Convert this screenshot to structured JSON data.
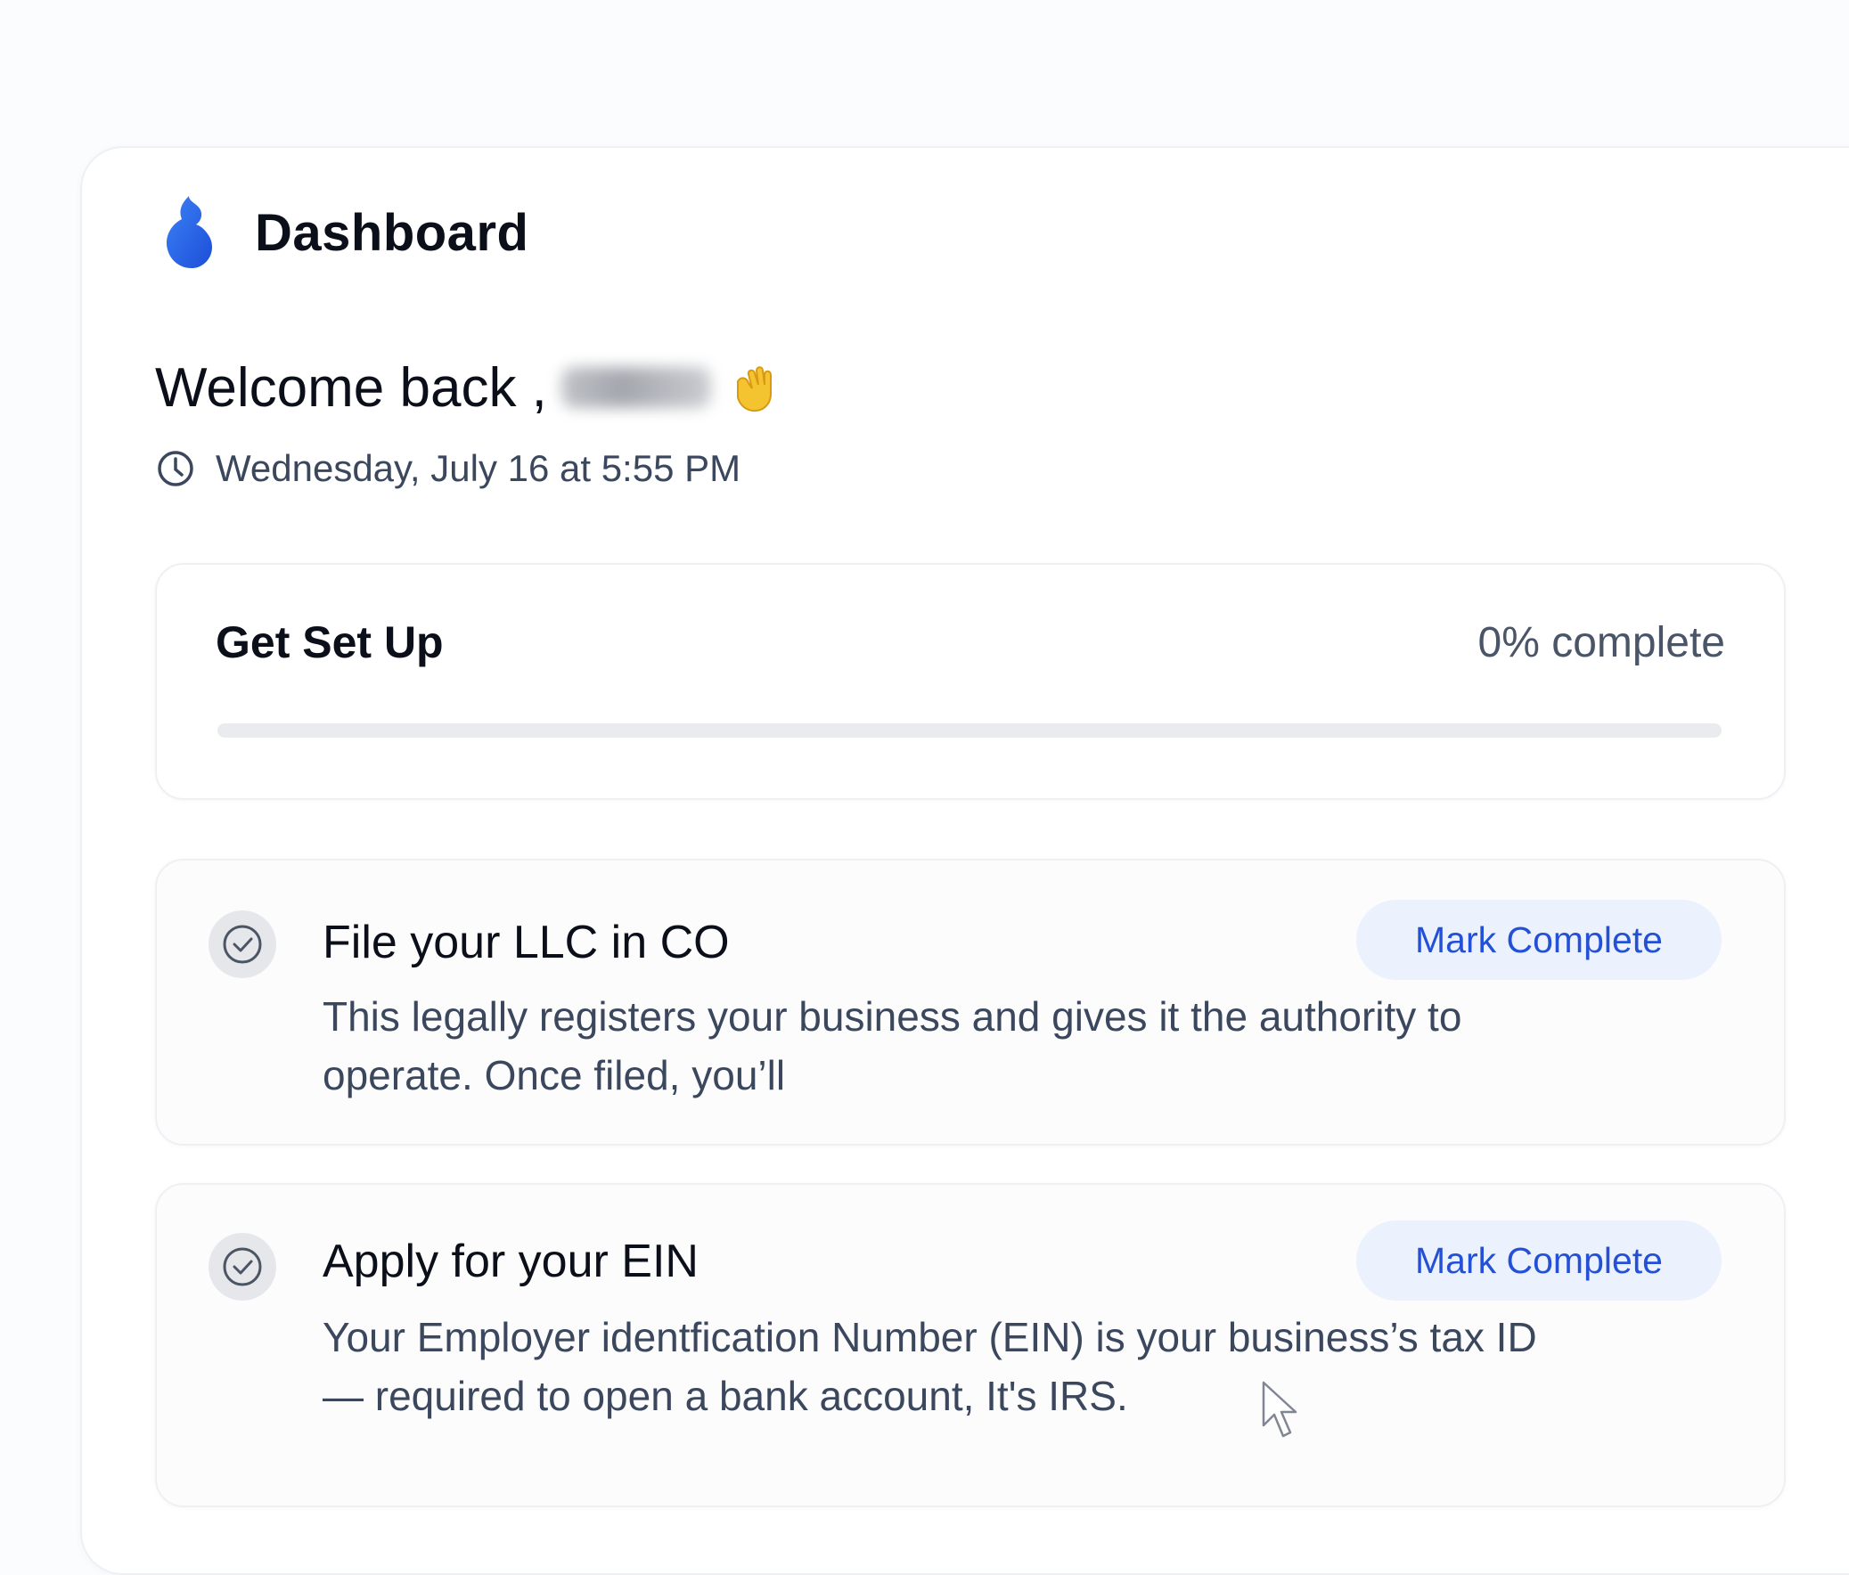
{
  "header": {
    "title": "Dashboard",
    "logo_icon": "drop-logo-icon",
    "brand_color": "#2563eb"
  },
  "welcome": {
    "greeting": "Welcome back ,",
    "emoji_icon": "waving-hand-icon"
  },
  "datetime": {
    "icon": "clock-icon",
    "text": "Wednesday, July 16 at 5:55 PM"
  },
  "setup": {
    "title": "Get Set Up",
    "progress_label": "0% complete",
    "progress_fraction": 0
  },
  "tasks": [
    {
      "title": "File your LLC in CO",
      "description": "This legally registers your business and gives it the authority to operate. Once filed, you’ll",
      "button_label": "Mark Complete",
      "status_icon": "check-circle-icon"
    },
    {
      "title": "Apply for your EIN",
      "description": "Your Employer identfication Number (EIN) is your business’s tax ID — required to open a bank account, It's IRS.",
      "button_label": "Mark Complete",
      "status_icon": "check-circle-icon"
    }
  ],
  "colors": {
    "background": "#fbfcfe",
    "card": "#ffffff",
    "button_bg": "#ebf2fe",
    "button_text": "#2450d6",
    "muted_text": "#3b475d"
  }
}
